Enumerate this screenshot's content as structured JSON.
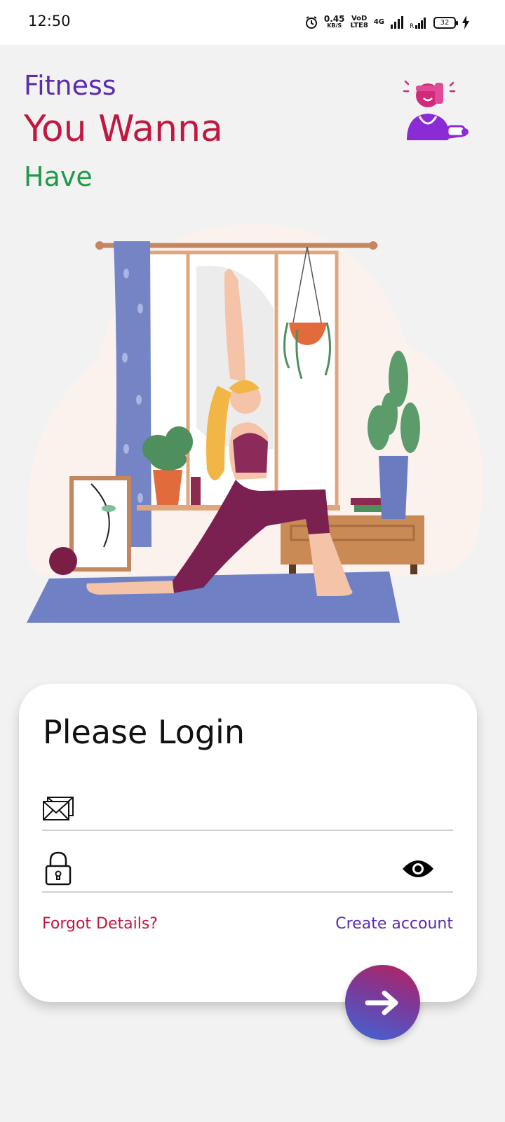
{
  "status_bar": {
    "time": "12:50",
    "net_speed_value": "0.45",
    "net_speed_unit": "KB/S",
    "volte_top": "VoD",
    "volte_bottom": "LTE8",
    "network": "4G",
    "battery": "32"
  },
  "header": {
    "line1": "Fitness",
    "line2": "You Wanna",
    "line3": "Have",
    "avatar_icon": "fitness-trainer-icon"
  },
  "illustration": {
    "icon": "yoga-woman-illustration"
  },
  "login": {
    "title": "Please Login",
    "email_value": "",
    "email_icon": "envelope-icon",
    "password_value": "",
    "password_icon": "lock-icon",
    "visibility_icon": "eye-icon",
    "forgot_label": "Forgot Details?",
    "create_label": "Create account",
    "submit_icon": "arrow-right-icon"
  },
  "colors": {
    "purple": "#5b2bb0",
    "crimson": "#c0183f",
    "green": "#1e9b48",
    "background": "#f2f2f2",
    "card": "#ffffff"
  }
}
